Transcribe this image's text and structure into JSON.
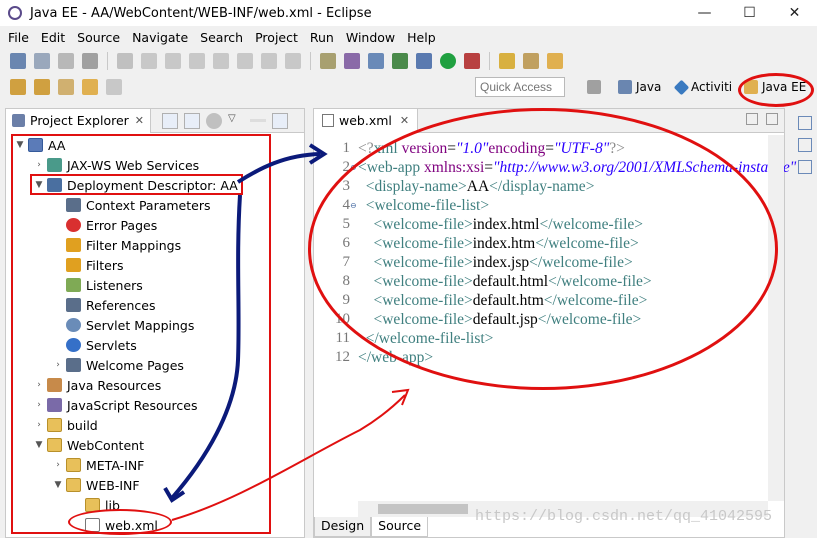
{
  "window": {
    "title": "Java EE - AA/WebContent/WEB-INF/web.xml - Eclipse",
    "controls": {
      "minimize": "—",
      "maximize": "☐",
      "close": "✕"
    }
  },
  "menubar": {
    "items": [
      "File",
      "Edit",
      "Source",
      "Navigate",
      "Search",
      "Project",
      "Run",
      "Window",
      "Help"
    ]
  },
  "toolbar": {
    "quick_access_placeholder": "Quick Access",
    "perspectives": [
      "Java",
      "Activiti",
      "Java EE"
    ]
  },
  "project_explorer": {
    "tab_label": "Project Explorer",
    "tree": [
      {
        "label": "AA",
        "arrow": "▼",
        "icon": "project-icon"
      },
      {
        "label": "JAX-WS Web Services",
        "arrow": "›",
        "icon": "webservice-icon"
      },
      {
        "label": "Deployment Descriptor: AA",
        "arrow": "▼",
        "icon": "deployment-descriptor-icon"
      },
      {
        "label": "Context Parameters",
        "arrow": "",
        "icon": "context-params-icon"
      },
      {
        "label": "Error Pages",
        "arrow": "",
        "icon": "error-icon"
      },
      {
        "label": "Filter Mappings",
        "arrow": "",
        "icon": "filter-mapping-icon"
      },
      {
        "label": "Filters",
        "arrow": "",
        "icon": "filter-icon"
      },
      {
        "label": "Listeners",
        "arrow": "",
        "icon": "listener-icon"
      },
      {
        "label": "References",
        "arrow": "",
        "icon": "references-icon"
      },
      {
        "label": "Servlet Mappings",
        "arrow": "",
        "icon": "servlet-mapping-icon"
      },
      {
        "label": "Servlets",
        "arrow": "",
        "icon": "servlet-icon"
      },
      {
        "label": "Welcome Pages",
        "arrow": "›",
        "icon": "welcome-pages-icon"
      },
      {
        "label": "Java Resources",
        "arrow": "›",
        "icon": "java-resources-icon"
      },
      {
        "label": "JavaScript Resources",
        "arrow": "›",
        "icon": "javascript-resources-icon"
      },
      {
        "label": "build",
        "arrow": "›",
        "icon": "folder-icon"
      },
      {
        "label": "WebContent",
        "arrow": "▼",
        "icon": "folder-icon"
      },
      {
        "label": "META-INF",
        "arrow": "›",
        "icon": "folder-icon"
      },
      {
        "label": "WEB-INF",
        "arrow": "▼",
        "icon": "folder-icon"
      },
      {
        "label": "lib",
        "arrow": "",
        "icon": "folder-icon"
      },
      {
        "label": "web.xml",
        "arrow": "",
        "icon": "xml-file-icon"
      }
    ]
  },
  "editor": {
    "tab_label": "web.xml",
    "bottom_tabs": [
      "Design",
      "Source"
    ],
    "line_numbers": [
      "1",
      "2",
      "3",
      "4",
      "5",
      "6",
      "7",
      "8",
      "9",
      "10",
      "11",
      "12"
    ],
    "lines": [
      [
        [
          "pi-c",
          "<?"
        ],
        [
          "tag",
          "xml "
        ],
        [
          "attr",
          "version"
        ],
        [
          "txt",
          "="
        ],
        [
          "val",
          "\"1.0\""
        ],
        [
          "attr",
          "encoding"
        ],
        [
          "txt",
          "="
        ],
        [
          "val",
          "\"UTF-8\""
        ],
        [
          "pi-c",
          "?>"
        ]
      ],
      [
        [
          "tag",
          "<web-app "
        ],
        [
          "attr",
          "xmlns:xsi"
        ],
        [
          "txt",
          "="
        ],
        [
          "val",
          "\"http://www.w3.org/2001/XMLSchema-instance\""
        ]
      ],
      [
        [
          "txt",
          "  "
        ],
        [
          "tag",
          "<display-name>"
        ],
        [
          "txt",
          "AA"
        ],
        [
          "tag",
          "</display-name>"
        ]
      ],
      [
        [
          "txt",
          "  "
        ],
        [
          "tag",
          "<welcome-file-list>"
        ]
      ],
      [
        [
          "txt",
          "    "
        ],
        [
          "tag",
          "<welcome-file>"
        ],
        [
          "txt",
          "index.html"
        ],
        [
          "tag",
          "</welcome-file>"
        ]
      ],
      [
        [
          "txt",
          "    "
        ],
        [
          "tag",
          "<welcome-file>"
        ],
        [
          "txt",
          "index.htm"
        ],
        [
          "tag",
          "</welcome-file>"
        ]
      ],
      [
        [
          "txt",
          "    "
        ],
        [
          "tag",
          "<welcome-file>"
        ],
        [
          "txt",
          "index.jsp"
        ],
        [
          "tag",
          "</welcome-file>"
        ]
      ],
      [
        [
          "txt",
          "    "
        ],
        [
          "tag",
          "<welcome-file>"
        ],
        [
          "txt",
          "default.html"
        ],
        [
          "tag",
          "</welcome-file>"
        ]
      ],
      [
        [
          "txt",
          "    "
        ],
        [
          "tag",
          "<welcome-file>"
        ],
        [
          "txt",
          "default.htm"
        ],
        [
          "tag",
          "</welcome-file>"
        ]
      ],
      [
        [
          "txt",
          "    "
        ],
        [
          "tag",
          "<welcome-file>"
        ],
        [
          "txt",
          "default.jsp"
        ],
        [
          "tag",
          "</welcome-file>"
        ]
      ],
      [
        [
          "txt",
          "  "
        ],
        [
          "tag",
          "</welcome-file-list>"
        ]
      ],
      [
        [
          "tag",
          "</web-app>"
        ]
      ]
    ]
  },
  "watermark": "https://blog.csdn.net/qq_41042595"
}
